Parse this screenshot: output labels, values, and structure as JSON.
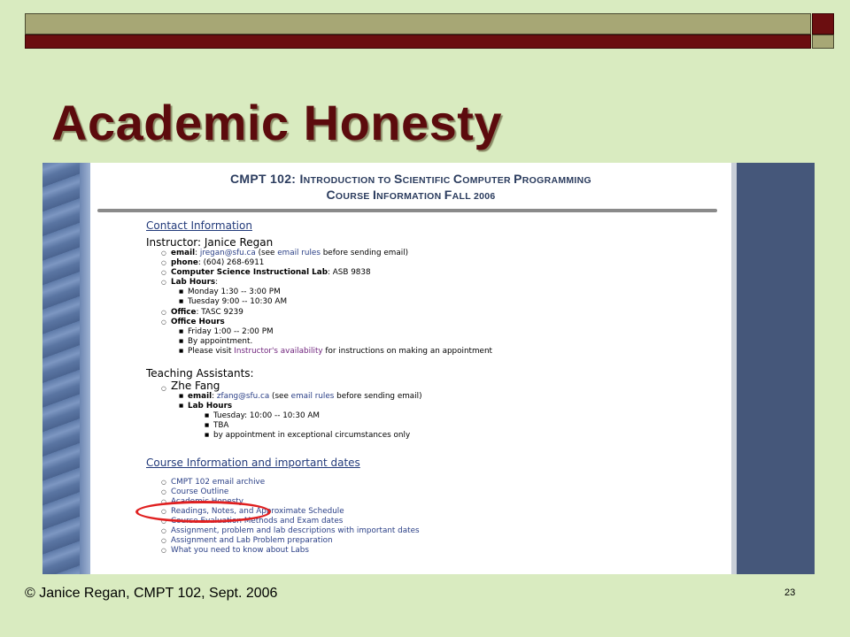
{
  "slide": {
    "title": "Academic Honesty",
    "footer": "© Janice Regan, CMPT 102, Sept. 2006",
    "page_number": "23"
  },
  "webpage": {
    "title_line1": {
      "prefix": "CMPT 102: ",
      "w1_cap": "I",
      "w1_rest": "NTRODUCTION TO ",
      "w2_cap": "S",
      "w2_rest": "CIENTIFIC ",
      "w3_cap": "C",
      "w3_rest": "OMPUTER ",
      "w4_cap": "P",
      "w4_rest": "ROGRAMMING"
    },
    "title_line2": {
      "w1_cap": "C",
      "w1_rest": "OURSE ",
      "w2_cap": "I",
      "w2_rest": "NFORMATION ",
      "w3_cap": "F",
      "w3_rest": "ALL 2006"
    },
    "contact_heading": "Contact Information",
    "instructor_heading": "Instructor: Janice Regan",
    "instructor": {
      "email_label": "email",
      "email_sep": ": ",
      "email_addr": "jregan@sfu.ca",
      "email_mid": " (see ",
      "email_rules": "email rules",
      "email_end": " before sending email)",
      "phone_label": "phone",
      "phone_value": ": (604) 268-6911",
      "lab_label": "Computer Science Instructional Lab",
      "lab_value": ": ASB 9838",
      "labhours_label": "Lab Hours",
      "labhours_colon": ":",
      "labhours": [
        "Monday 1:30 -- 3:00 PM",
        "Tuesday 9:00 -- 10:30 AM"
      ],
      "office_label": "Office",
      "office_value": ": TASC 9239",
      "officehours_label": "Office Hours",
      "officehours_1": "Friday 1:00 -- 2:00 PM",
      "officehours_2": "By appointment.",
      "officehours_3_pre": "Please visit ",
      "officehours_3_link": "Instructor's availability",
      "officehours_3_post": " for instructions on making an appointment"
    },
    "ta_heading": "Teaching Assistants:",
    "ta": {
      "name": "Zhe Fang",
      "email_label": "email",
      "email_sep": ": ",
      "email_addr": "zfang@sfu.ca",
      "email_mid": " (see ",
      "email_rules": "email rules",
      "email_end": " before sending email)",
      "labhours_label": "Lab Hours",
      "labhours": [
        "Tuesday: 10:00 -- 10:30 AM",
        "TBA",
        "by appointment in exceptional circumstances only"
      ]
    },
    "course_info_heading": "Course Information and important dates",
    "course_links": [
      "CMPT 102 email archive",
      "Course Outline",
      "Academic Honesty",
      "Readings, Notes, and Approximate Schedule",
      "Course Evaluation Methods and Exam dates",
      "Assignment, problem and lab descriptions with important dates",
      "Assignment and Lab Problem preparation",
      "What you need to know about Labs"
    ]
  }
}
